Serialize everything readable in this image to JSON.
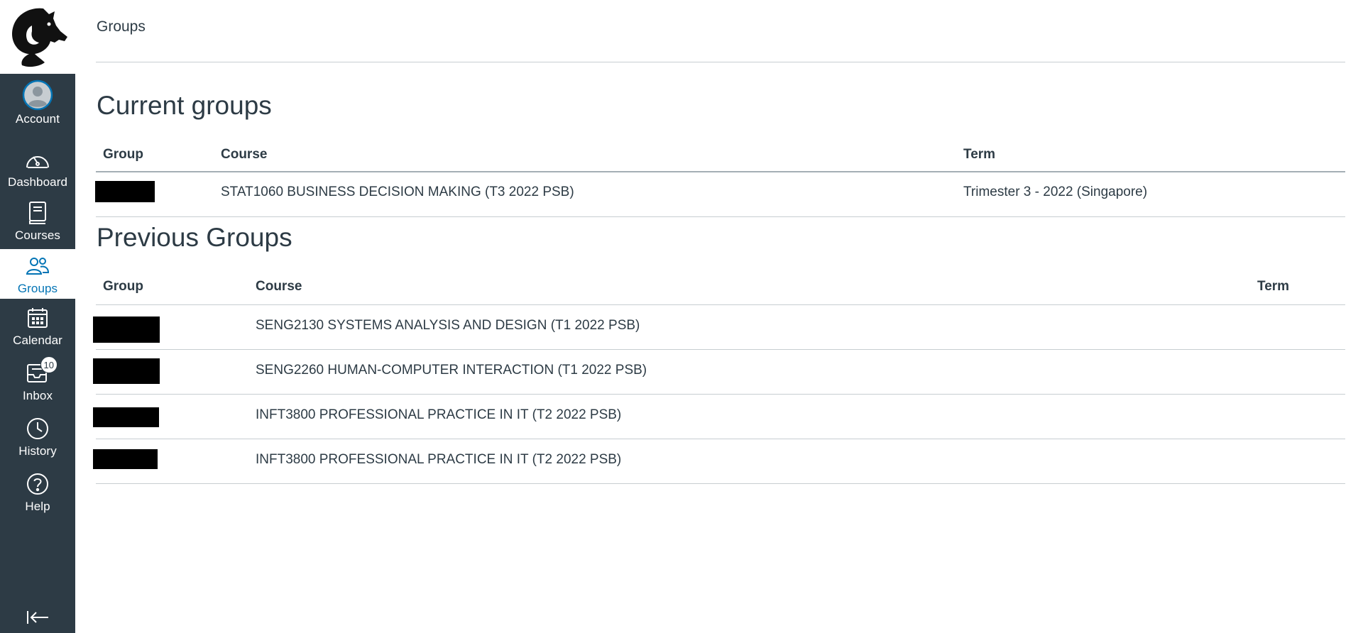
{
  "page": {
    "breadcrumb": "Groups"
  },
  "sidebar": {
    "logo": "horse-head-logo",
    "items": [
      {
        "label": "Account",
        "icon": "user-avatar-icon",
        "active": false
      },
      {
        "label": "Dashboard",
        "icon": "speedometer-icon",
        "active": false
      },
      {
        "label": "Courses",
        "icon": "book-icon",
        "active": false
      },
      {
        "label": "Groups",
        "icon": "people-icon",
        "active": true
      },
      {
        "label": "Calendar",
        "icon": "calendar-icon",
        "active": false
      },
      {
        "label": "Inbox",
        "icon": "inbox-icon",
        "active": false,
        "badge": "10"
      },
      {
        "label": "History",
        "icon": "clock-icon",
        "active": false
      },
      {
        "label": "Help",
        "icon": "question-icon",
        "active": false
      }
    ],
    "collapse_icon": "collapse-left-icon"
  },
  "current_groups": {
    "title": "Current groups",
    "headers": {
      "group": "Group",
      "course": "Course",
      "term": "Term"
    },
    "rows": [
      {
        "group": "",
        "course": "STAT1060 BUSINESS DECISION MAKING (T3 2022 PSB)",
        "term": "Trimester 3 - 2022 (Singapore)"
      }
    ]
  },
  "previous_groups": {
    "title": "Previous Groups",
    "headers": {
      "group": "Group",
      "course": "Course",
      "term": "Term"
    },
    "rows": [
      {
        "group": "",
        "course": "SENG2130 SYSTEMS ANALYSIS AND DESIGN (T1 2022 PSB)",
        "term": ""
      },
      {
        "group": "",
        "course": "SENG2260 HUMAN-COMPUTER INTERACTION (T1 2022 PSB)",
        "term": ""
      },
      {
        "group": "",
        "course": "INFT3800 PROFESSIONAL PRACTICE IN IT (T2 2022 PSB)",
        "term": ""
      },
      {
        "group": "",
        "course": "INFT3800 PROFESSIONAL PRACTICE IN IT (T2 2022 PSB)",
        "term": ""
      }
    ]
  },
  "colors": {
    "sidebar_bg": "#2d3b45",
    "active_link": "#0374b5",
    "text": "#2d3b45"
  }
}
